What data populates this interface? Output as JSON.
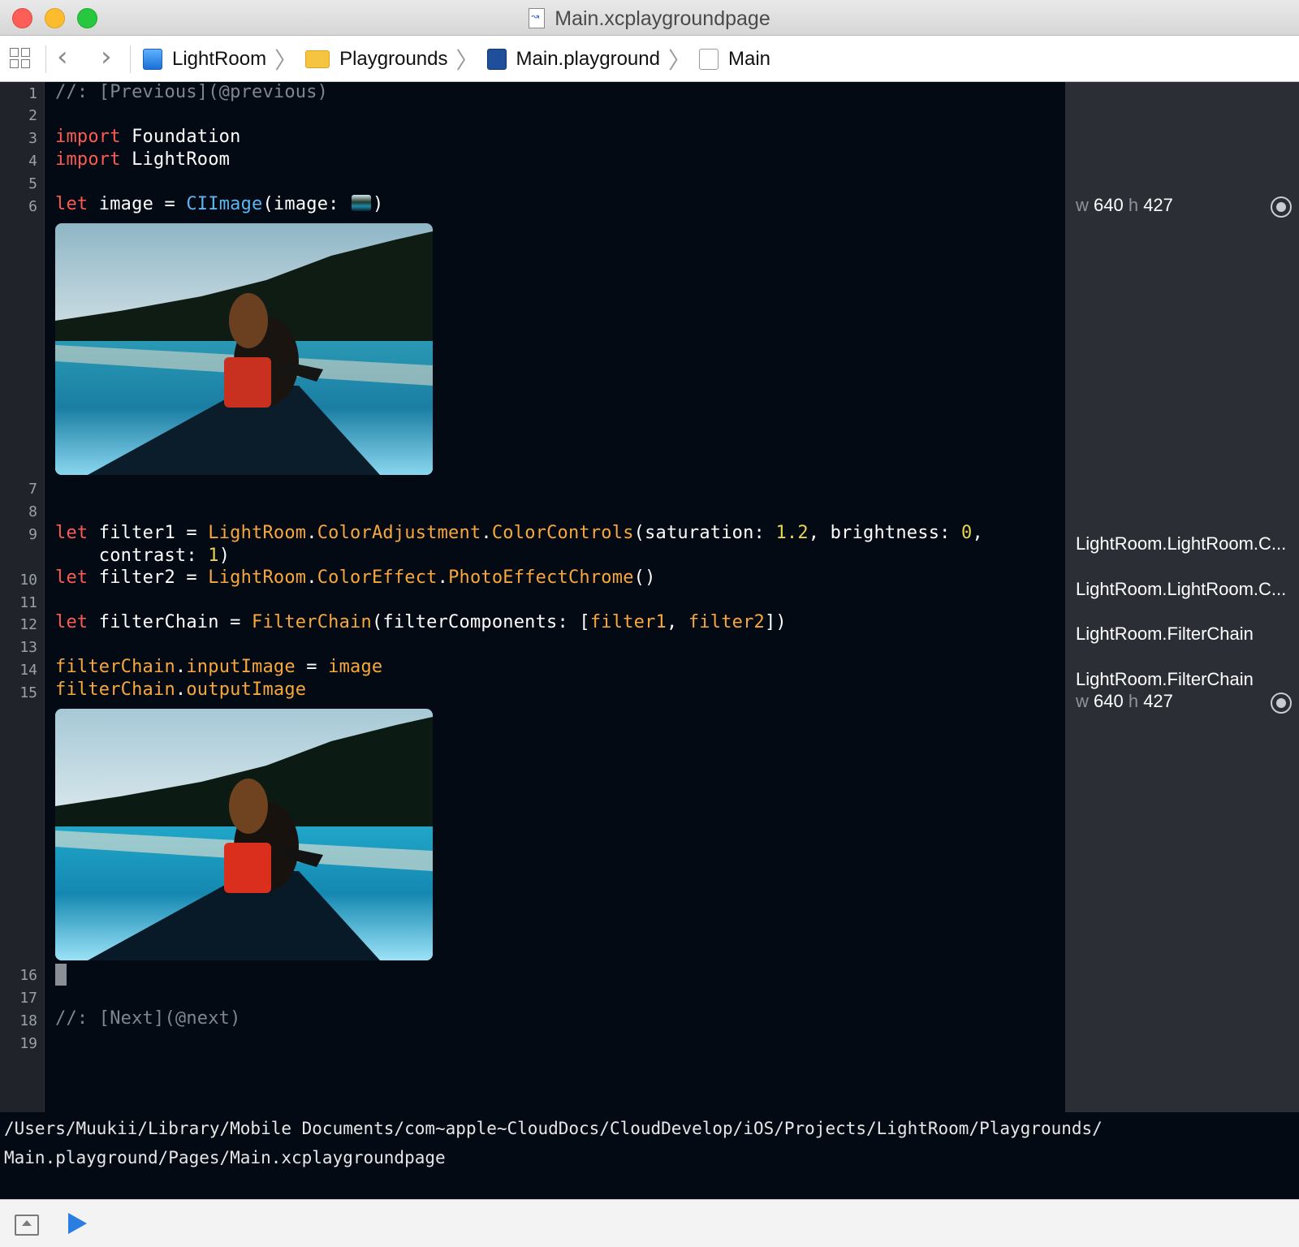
{
  "window": {
    "title": "Main.xcplaygroundpage"
  },
  "breadcrumbs": [
    {
      "label": "LightRoom",
      "icon": "project-icon"
    },
    {
      "label": "Playgrounds",
      "icon": "folder-icon"
    },
    {
      "label": "Main.playground",
      "icon": "playground-icon"
    },
    {
      "label": "Main",
      "icon": "page-icon"
    }
  ],
  "code": {
    "line_numbers": [
      "1",
      "2",
      "3",
      "4",
      "5",
      "6",
      "7",
      "8",
      "9",
      "10",
      "11",
      "12",
      "13",
      "14",
      "15",
      "16",
      "17",
      "18",
      "19"
    ],
    "l1": "//: [Previous](@previous)",
    "l3_kw": "import",
    "l3_rest": " Foundation",
    "l4_kw": "import",
    "l4_rest": " LightRoom",
    "l6_kw": "let",
    "l6_a": " image = ",
    "l6_ty": "CIImage",
    "l6_b": "(image: ",
    "l6_c": ")",
    "l9_kw": "let",
    "l9_a": " filter1 = ",
    "l9_c1": "LightRoom",
    "l9_d1": ".",
    "l9_c2": "ColorAdjustment",
    "l9_d2": ".",
    "l9_c3": "ColorControls",
    "l9_b": "(saturation: ",
    "l9_n1": "1.2",
    "l9_e": ", brightness: ",
    "l9_n2": "0",
    "l9_f": ",",
    "l9w_a": "    contrast: ",
    "l9w_n": "1",
    "l9w_b": ")",
    "l10_kw": "let",
    "l10_a": " filter2 = ",
    "l10_c1": "LightRoom",
    "l10_d1": ".",
    "l10_c2": "ColorEffect",
    "l10_d2": ".",
    "l10_c3": "PhotoEffectChrome",
    "l10_b": "()",
    "l12_kw": "let",
    "l12_a": " filterChain = ",
    "l12_c1": "FilterChain",
    "l12_b": "(filterComponents: [",
    "l12_c2": "filter1",
    "l12_e": ", ",
    "l12_c3": "filter2",
    "l12_f": "])",
    "l14_c1": "filterChain",
    "l14_d": ".",
    "l14_c2": "inputImage",
    "l14_a": " = ",
    "l14_c3": "image",
    "l15_c1": "filterChain",
    "l15_d": ".",
    "l15_c2": "outputImage",
    "l18": "//: [Next](@next)"
  },
  "results": {
    "r6_w": "w",
    "r6_wv": " 640 ",
    "r6_h": "h",
    "r6_hv": " 427",
    "r9": "LightRoom.LightRoom.C...",
    "r10": "LightRoom.LightRoom.C...",
    "r12": "LightRoom.FilterChain",
    "r14": "LightRoom.FilterChain",
    "r15_w": "w",
    "r15_wv": " 640 ",
    "r15_h": "h",
    "r15_hv": " 427"
  },
  "console": {
    "line1": "/Users/Muukii/Library/Mobile Documents/com~apple~CloudDocs/CloudDevelop/iOS/Projects/LightRoom/Playgrounds/",
    "line2": "Main.playground/Pages/Main.xcplaygroundpage"
  },
  "colors": {
    "keyword": "#fc5b53",
    "type": "#5cb6ef",
    "class": "#f7a73b",
    "number": "#e8d44d",
    "comment": "#7f8690",
    "editor_bg": "#040a14"
  }
}
